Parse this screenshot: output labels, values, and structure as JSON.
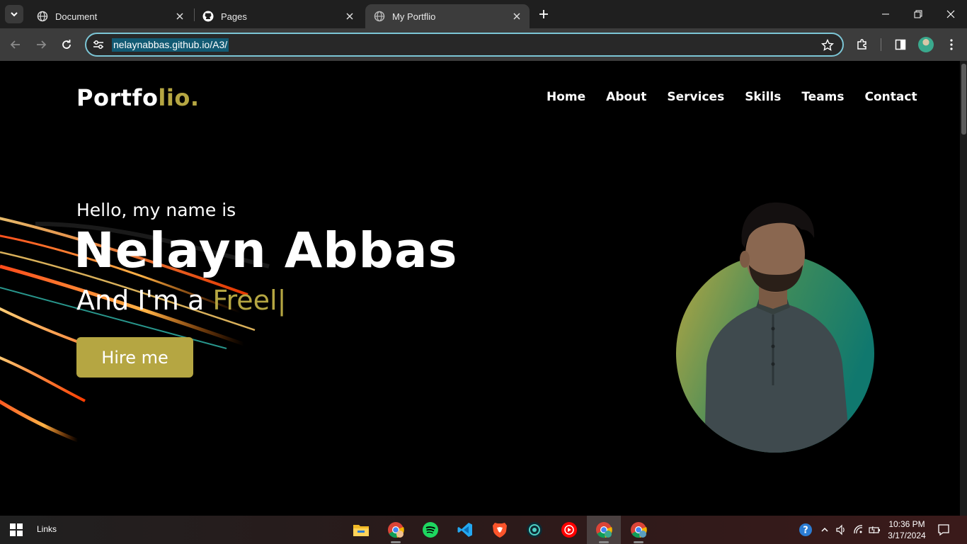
{
  "browser": {
    "tabs": [
      {
        "title": "Document",
        "icon": "globe-icon"
      },
      {
        "title": "Pages",
        "icon": "github-icon"
      },
      {
        "title": "My Portflio",
        "icon": "globe-icon",
        "active": true
      }
    ],
    "url": "nelaynabbas.github.io/A3/"
  },
  "site": {
    "logo_main": "Portfo",
    "logo_accent": "lio.",
    "nav": [
      "Home",
      "About",
      "Services",
      "Skills",
      "Teams",
      "Contact"
    ],
    "hero": {
      "greeting": "Hello, my name is",
      "name": "Nelayn Abbas",
      "role_prefix": "And I'm a ",
      "role_typed": "Freel",
      "cursor": "|",
      "cta": "Hire me"
    },
    "accent_color": "#b5a642"
  },
  "taskbar": {
    "links_label": "Links",
    "apps": [
      "file-explorer-icon",
      "chrome-icon",
      "spotify-icon",
      "vscode-icon",
      "brave-icon",
      "app-icon",
      "youtube-music-icon",
      "chrome-icon",
      "chrome-icon"
    ],
    "time": "10:36 PM",
    "date": "3/17/2024"
  }
}
